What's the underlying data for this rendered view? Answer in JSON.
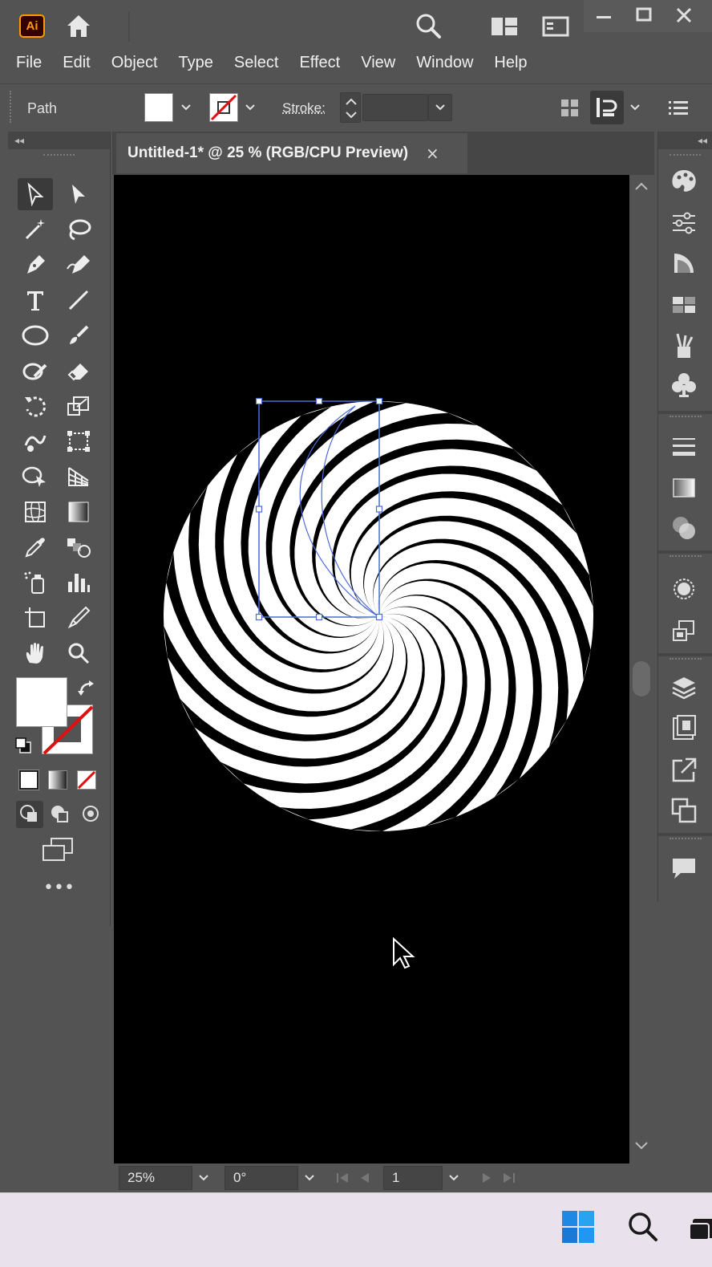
{
  "app": {
    "logo_text": "Ai",
    "brand_color": "#ff9a00"
  },
  "menubar": {
    "items": [
      "File",
      "Edit",
      "Object",
      "Type",
      "Select",
      "Effect",
      "View",
      "Window",
      "Help"
    ]
  },
  "controlbar": {
    "selection_type": "Path",
    "stroke_label": "Stroke:",
    "fill_color": "#ffffff",
    "stroke_color": "none"
  },
  "document": {
    "tab_title": "Untitled-1* @ 25 % (RGB/CPU Preview)",
    "close_glyph": "×",
    "canvas_bg": "#000000"
  },
  "artwork": {
    "description_icon": "spiral-swirl",
    "stripe_count": 18
  },
  "statusbar": {
    "zoom": "25%",
    "rotation": "0°",
    "artboard": "1"
  },
  "icons": {
    "home": "home-icon",
    "search": "search-icon",
    "arrange": "arrange-documents-icon",
    "workspace": "workspace-icon",
    "minimize": "minimize-icon",
    "maximize": "maximize-icon",
    "close": "close-icon"
  }
}
